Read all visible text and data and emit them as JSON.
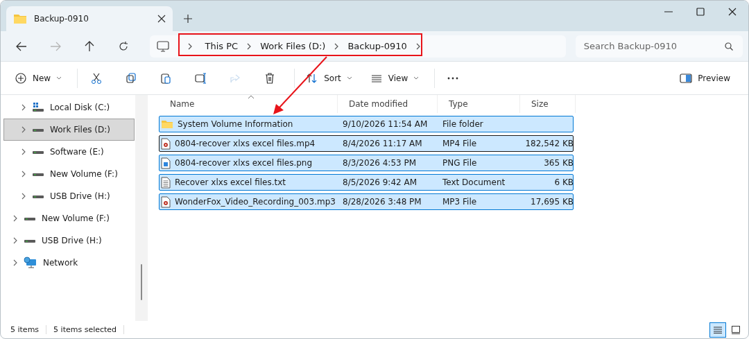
{
  "window": {
    "tab": {
      "title": "Backup-0910",
      "selected": true
    }
  },
  "address": {
    "crumbs": [
      "This PC",
      "Work Files (D:)",
      "Backup-0910"
    ]
  },
  "search": {
    "placeholder": "Search Backup-0910"
  },
  "toolbar": [
    {
      "kind": "new",
      "label": "New",
      "disabled": false
    },
    {
      "kind": "cut",
      "disabled": false
    },
    {
      "kind": "copy",
      "disabled": false
    },
    {
      "kind": "paste",
      "disabled": false
    },
    {
      "kind": "rename",
      "disabled": false
    },
    {
      "kind": "share",
      "disabled": true
    },
    {
      "kind": "delete",
      "disabled": false
    },
    {
      "kind": "sort",
      "label": "Sort",
      "disabled": false
    },
    {
      "kind": "view",
      "label": "View",
      "disabled": false
    },
    {
      "kind": "more",
      "disabled": false
    }
  ],
  "preview_button": {
    "label": "Preview"
  },
  "sidebar": {
    "items": [
      {
        "children": [
          {
            "label": "Local Disk (C:)",
            "kind": "system",
            "selected": false
          },
          {
            "label": "Work Files (D:)",
            "kind": "drive",
            "selected": true
          },
          {
            "label": "Software (E:)",
            "kind": "drive",
            "selected": false
          },
          {
            "label": "New Volume (F:)",
            "kind": "drive",
            "selected": false
          },
          {
            "label": "USB Drive (H:)",
            "kind": "drive",
            "selected": false
          }
        ]
      },
      {
        "label": "New Volume (F:)",
        "kind": "drive",
        "selected": false
      },
      {
        "label": "USB Drive (H:)",
        "kind": "drive",
        "selected": false
      },
      {
        "label": "Network",
        "kind": "network",
        "selected": false
      }
    ]
  },
  "table": {
    "columns": [
      "Name",
      "Date modified",
      "Type",
      "Size"
    ],
    "rows": [
      {
        "name": "System Volume Information",
        "date": "9/10/2026 11:54 AM",
        "type": "File folder",
        "kind": "folder",
        "selected": true,
        "focused": false
      },
      {
        "name": "0804-recover xlxs excel files.mp4",
        "date": "8/4/2026 11:17 AM",
        "type": "MP4 File",
        "size": "182,542 KB",
        "kind": "media",
        "selected": true,
        "focused": true
      },
      {
        "name": "0804-recover xlxs excel files.png",
        "date": "8/3/2026 4:53 PM",
        "type": "PNG File",
        "size": "365 KB",
        "kind": "image",
        "selected": true,
        "focused": false
      },
      {
        "name": "Recover xlxs excel files.txt",
        "date": "8/5/2026 9:42 AM",
        "type": "Text Document",
        "size": "6 KB",
        "kind": "text",
        "selected": true,
        "focused": false
      },
      {
        "name": "WonderFox_Video_Recording_003.mp3",
        "date": "8/28/2026 3:48 PM",
        "type": "MP3 File",
        "size": "17,695 KB",
        "kind": "media",
        "selected": true,
        "focused": false
      }
    ]
  },
  "status_bar": {
    "count": "5 items",
    "selection": "5 items selected",
    "view_buttons": [
      {
        "kind": "details",
        "selected": true
      },
      {
        "kind": "tiles",
        "selected": false
      }
    ]
  }
}
